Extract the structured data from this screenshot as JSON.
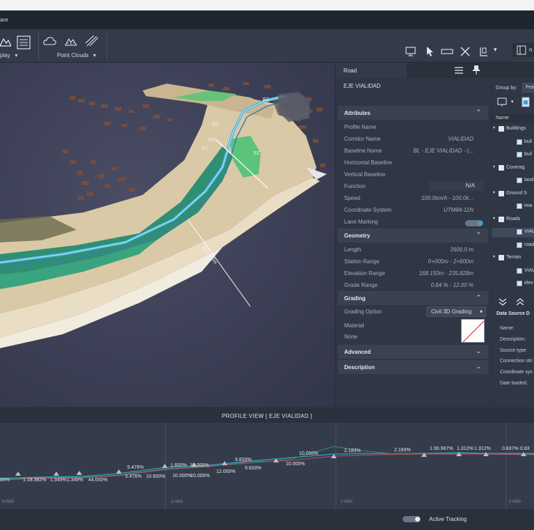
{
  "titlebar": {
    "app_title_fragment": "are"
  },
  "ribbon": {
    "display_label": "play",
    "point_clouds_label": "Point Clouds"
  },
  "viewport": {
    "labels": [
      "EC",
      "EC",
      "EC",
      "EC",
      "EC"
    ],
    "distance_label": "347.432m"
  },
  "properties": {
    "tab_title": "Road",
    "subtitle": "EJE VIALIDAD",
    "sections": {
      "attributes": "Attributes",
      "geometry": "Geometry",
      "grading": "Grading",
      "advanced": "Advanced",
      "description": "Description"
    },
    "attributes": [
      {
        "key": "Profile Name",
        "value": ""
      },
      {
        "key": "Corridor Name",
        "value": "VIALIDAD"
      },
      {
        "key": "Baseline Name",
        "value": "BL - EJE VIALIDAD - (..."
      },
      {
        "key": "Horizontal Baseline",
        "value": ""
      },
      {
        "key": "Vertical Baseline",
        "value": ""
      },
      {
        "key": "Function",
        "value": "N/A"
      },
      {
        "key": "Speed",
        "value": "100.0km/h - 100.0k..."
      },
      {
        "key": "Coordinate System",
        "value": "UTM84-11N"
      },
      {
        "key": "Lane Marking",
        "value": ""
      }
    ],
    "geometry": [
      {
        "key": "Length",
        "value": "2600.0  m"
      },
      {
        "key": "Station Range",
        "value": "0+000m - 2+600m"
      },
      {
        "key": "Elevation Range",
        "value": "168.150m - 235.828m"
      },
      {
        "key": "Grade Range",
        "value": "0.84 % - 12.00 %"
      }
    ],
    "grading": {
      "option_key": "Grading Option",
      "option_value": "Civil 3D Grading",
      "material_key": "Material",
      "material_value": "None"
    }
  },
  "right_panel": {
    "group_by_label": "Group by:",
    "group_by_value": "Fea",
    "name_header": "Name",
    "tree": [
      {
        "label": "Buildings",
        "level": 0,
        "folder": true
      },
      {
        "label": "buil",
        "level": 1,
        "folder": false
      },
      {
        "label": "buil",
        "level": 1,
        "folder": false
      },
      {
        "label": "Coverag",
        "level": 0,
        "folder": true
      },
      {
        "label": "land",
        "level": 1,
        "folder": false
      },
      {
        "label": "Ground S",
        "level": 0,
        "folder": true
      },
      {
        "label": "ima",
        "level": 1,
        "folder": false
      },
      {
        "label": "Roads",
        "level": 0,
        "folder": true
      },
      {
        "label": "VIAL",
        "level": 1,
        "folder": false,
        "selected": true
      },
      {
        "label": "road",
        "level": 1,
        "folder": false
      },
      {
        "label": "Terrain",
        "level": 0,
        "folder": true
      },
      {
        "label": "VIAL",
        "level": 1,
        "folder": false
      },
      {
        "label": "elev",
        "level": 1,
        "folder": false
      }
    ],
    "data_source_title": "Data Source D",
    "data_source_fields": [
      "Name:",
      "Description:",
      "Source type:",
      "Connection stri",
      "Coordinate sys",
      "Date loaded:"
    ]
  },
  "profile_view": {
    "title": "PROFILE VIEW [ EJE VIALIDAD ]",
    "grade_labels": [
      "00%",
      "1.18.382%",
      "1.349%",
      "1.349%",
      "44.000%",
      "5.476%",
      "5.476%",
      "10.600%",
      "1.600%",
      "12.000%",
      "10.000%",
      "10.000%",
      "9.833%",
      "12.000%",
      "9.833%",
      "10.000%",
      "10.000%",
      "2.183%",
      "2.183%",
      "1.90.967%",
      "1.312%",
      "1.312%",
      "0.837%",
      "0.83"
    ],
    "station_ticks": [
      "0+500",
      "1+000",
      "1+500",
      "2+000"
    ]
  },
  "status": {
    "active_tracking_label": "Active Tracking"
  }
}
